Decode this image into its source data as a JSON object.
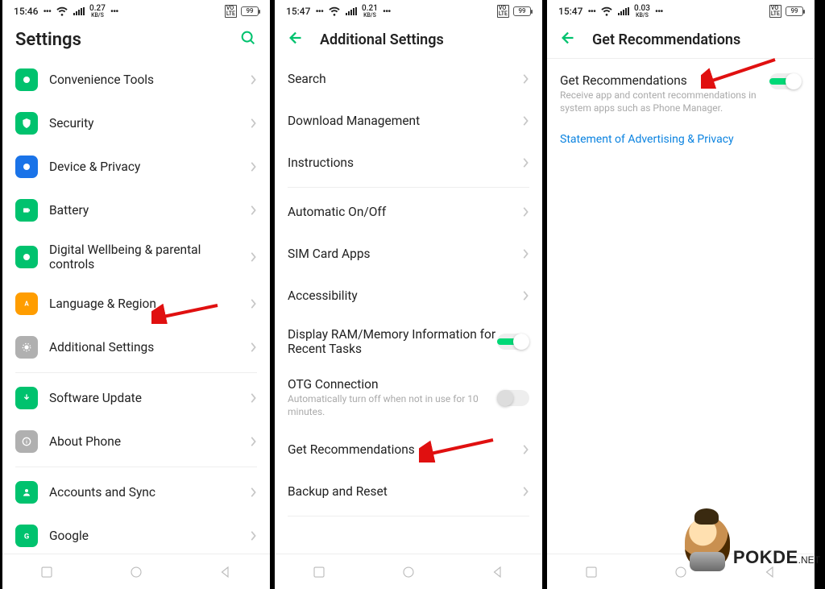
{
  "screens": [
    {
      "status": {
        "time": "15:46",
        "speed": "0.27",
        "unit": "KB/S",
        "volte": "VO\nLTE",
        "battery": "99"
      },
      "title": "Settings",
      "items": [
        {
          "label": "Convenience Tools",
          "icon": "tools-icon",
          "bg": "#00c26e"
        },
        {
          "label": "Security",
          "icon": "shield-icon",
          "bg": "#00c26e"
        },
        {
          "label": "Device & Privacy",
          "icon": "privacy-icon",
          "bg": "#1a73e8"
        },
        {
          "label": "Battery",
          "icon": "battery-icon",
          "bg": "#00c26e"
        },
        {
          "label": "Digital Wellbeing & parental controls",
          "icon": "wellbeing-icon",
          "bg": "#00c26e"
        },
        {
          "label": "Language & Region",
          "icon": "language-icon",
          "bg": "#ff9d00"
        },
        {
          "label": "Additional Settings",
          "icon": "settings-icon",
          "bg": "#b0b0b0",
          "highlight": true
        },
        {
          "sep": true
        },
        {
          "label": "Software Update",
          "icon": "update-icon",
          "bg": "#00c26e"
        },
        {
          "label": "About Phone",
          "icon": "about-icon",
          "bg": "#b0b0b0"
        },
        {
          "sep": true
        },
        {
          "label": "Accounts and Sync",
          "icon": "accounts-icon",
          "bg": "#00c26e"
        },
        {
          "label": "Google",
          "icon": "google-icon",
          "bg": "#00c26e"
        }
      ]
    },
    {
      "status": {
        "time": "15:47",
        "speed": "0.21",
        "unit": "KB/S",
        "volte": "VO\nLTE",
        "battery": "99"
      },
      "title": "Additional Settings",
      "groups": [
        [
          {
            "label": "Search"
          },
          {
            "label": "Download Management"
          },
          {
            "label": "Instructions"
          }
        ],
        [
          {
            "label": "Automatic On/Off"
          },
          {
            "label": "SIM Card Apps"
          },
          {
            "label": "Accessibility"
          },
          {
            "label": "Display RAM/Memory Information for Recent Tasks",
            "toggle": true,
            "on": true
          },
          {
            "label": "OTG Connection",
            "sub": "Automatically turn off when not in use for 10 minutes.",
            "toggle": true,
            "on": false
          },
          {
            "label": "Get Recommendations",
            "highlight": true
          },
          {
            "label": "Backup and Reset"
          }
        ]
      ]
    },
    {
      "status": {
        "time": "15:47",
        "speed": "0.03",
        "unit": "KB/S",
        "volte": "VO\nLTE",
        "battery": "99"
      },
      "title": "Get Recommendations",
      "get_rec": {
        "label": "Get Recommendations",
        "sub": "Receive app and content recommendations in system apps such as Phone Manager.",
        "on": true
      },
      "link": "Statement of Advertising & Privacy"
    }
  ],
  "watermark": "POKDE",
  "watermark_net": ".NET"
}
